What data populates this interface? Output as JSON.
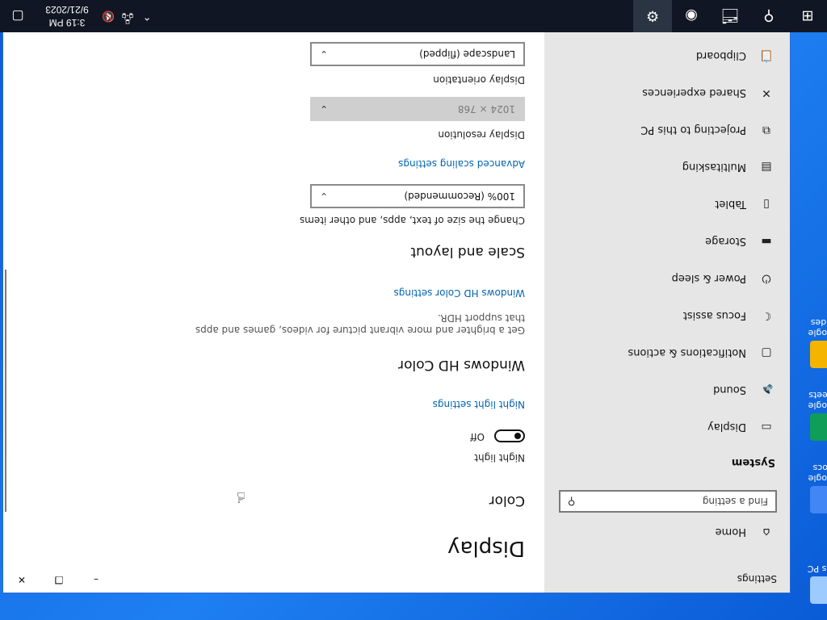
{
  "taskbar": {
    "time": "3:19 PM",
    "date": "9/21/2023"
  },
  "desktop_icons": [
    {
      "label": "Google Docs",
      "color": "#4285f4"
    },
    {
      "label": "Google Sheets",
      "color": "#0f9d58"
    },
    {
      "label": "Google Slides",
      "color": "#f4b400"
    },
    {
      "label": "This PC",
      "color": "#9ecbff"
    }
  ],
  "settings": {
    "window_title": "Settings",
    "nav": {
      "home": "Home",
      "search_placeholder": "Find a setting",
      "section": "System",
      "items": [
        {
          "label": "Display",
          "icon": "monitor-icon"
        },
        {
          "label": "Sound",
          "icon": "speaker-icon"
        },
        {
          "label": "Notifications & actions",
          "icon": "notification-icon"
        },
        {
          "label": "Focus assist",
          "icon": "moon-icon"
        },
        {
          "label": "Power & sleep",
          "icon": "power-icon"
        },
        {
          "label": "Storage",
          "icon": "storage-icon"
        },
        {
          "label": "Tablet",
          "icon": "tablet-icon"
        },
        {
          "label": "Multitasking",
          "icon": "multitasking-icon"
        },
        {
          "label": "Projecting to this PC",
          "icon": "projector-icon"
        },
        {
          "label": "Shared experiences",
          "icon": "shared-icon"
        },
        {
          "label": "Clipboard",
          "icon": "clipboard-icon"
        }
      ]
    },
    "content": {
      "title": "Display",
      "color_heading": "Color",
      "night_light_label": "Night light",
      "night_light_state": "Off",
      "night_light_link": "Night light settings",
      "hd_heading": "Windows HD Color",
      "hd_desc": "Get a brighter and more vibrant picture for videos, games and apps that support HDR.",
      "hd_link": "Windows HD Color settings",
      "scale_heading": "Scale and layout",
      "scale_label": "Change the size of text, apps, and other items",
      "scale_value": "100% (Recommended)",
      "advanced_link": "Advanced scaling settings",
      "resolution_label": "Display resolution",
      "resolution_value": "1024 × 768",
      "orientation_label": "Display orientation",
      "orientation_value": "Landscape (flipped)"
    }
  }
}
